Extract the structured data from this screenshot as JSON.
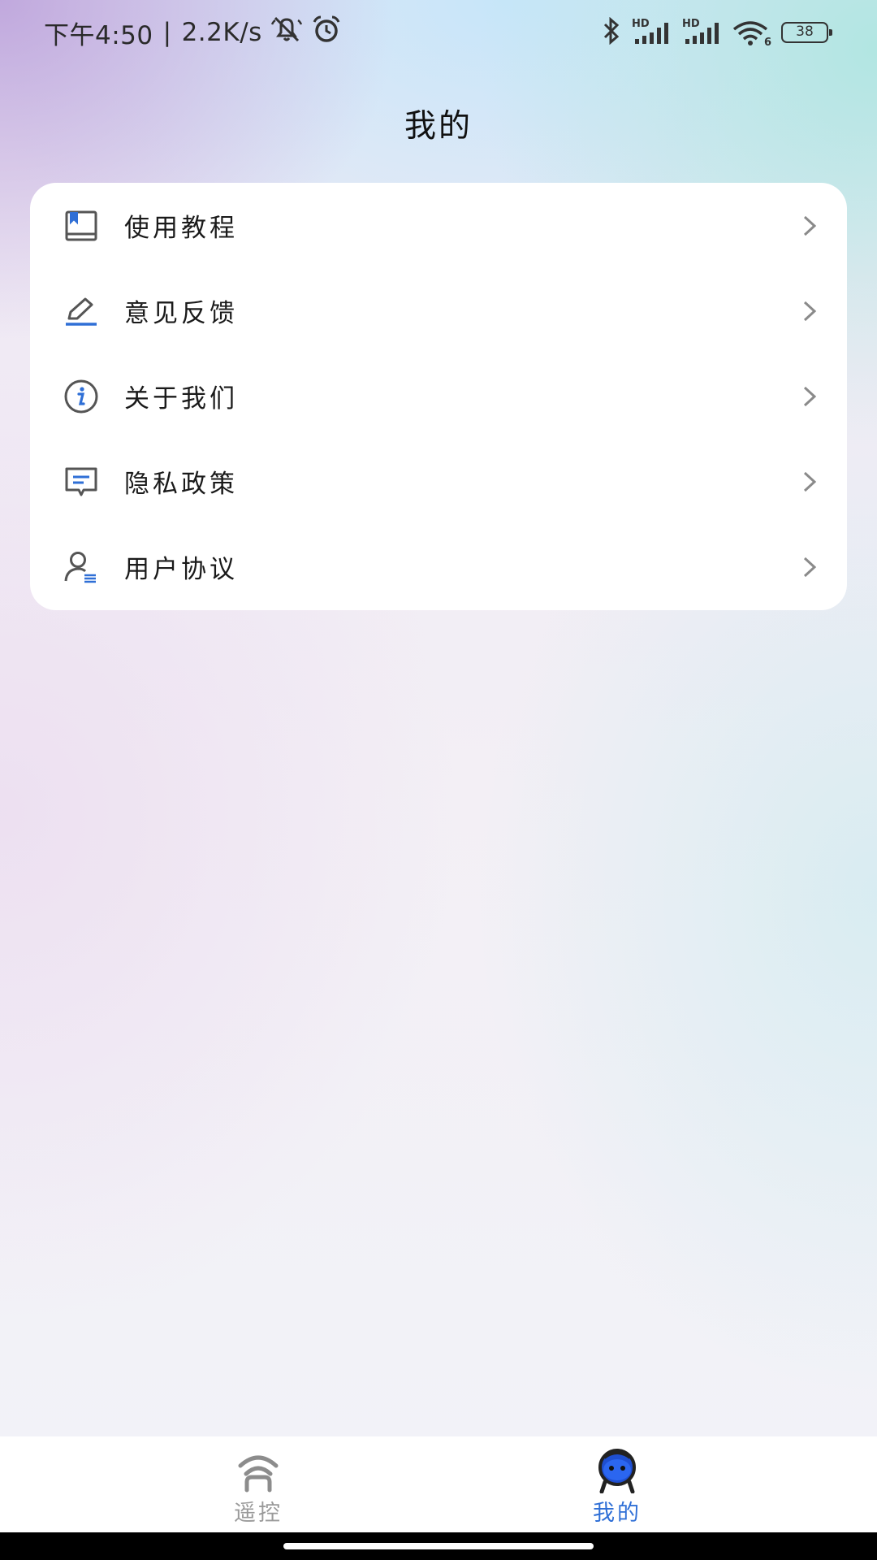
{
  "status_bar": {
    "time": "下午4:50",
    "separator": "|",
    "net_speed": "2.2K/s",
    "battery": "38",
    "signal_1_label": "HD",
    "signal_2_label": "HD",
    "wifi_sub": "6",
    "icons": [
      "mute-bell-icon",
      "alarm-icon",
      "bluetooth-icon",
      "signal-icon",
      "signal-icon",
      "wifi-icon",
      "battery-icon"
    ]
  },
  "header": {
    "title": "我的"
  },
  "menu": {
    "items": [
      {
        "label": "使用教程",
        "icon": "book-icon"
      },
      {
        "label": "意见反馈",
        "icon": "pen-edit-icon"
      },
      {
        "label": "关于我们",
        "icon": "info-icon"
      },
      {
        "label": "隐私政策",
        "icon": "document-icon"
      },
      {
        "label": "用户协议",
        "icon": "user-agreement-icon"
      }
    ],
    "chevron_icon": "chevron-right-icon"
  },
  "bottom_nav": {
    "tabs": [
      {
        "label": "遥控",
        "icon": "remote-icon",
        "active": false
      },
      {
        "label": "我的",
        "icon": "robot-avatar-icon",
        "active": true
      }
    ]
  },
  "colors": {
    "accent": "#2f6fd6",
    "icon_gray": "#555555",
    "inactive_tab": "#9a9a9a",
    "card_bg": "#ffffff"
  }
}
